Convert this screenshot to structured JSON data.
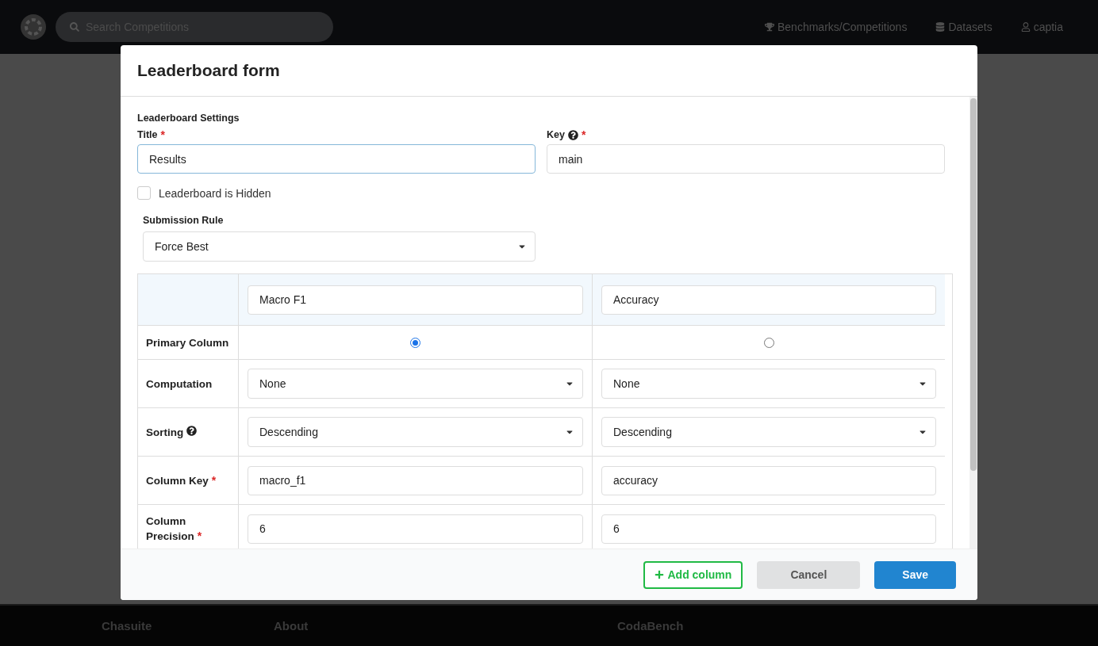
{
  "navbar": {
    "search": {
      "placeholder": "Search Competitions"
    },
    "links": [
      {
        "label": "Benchmarks/Competitions",
        "kind": "trophy"
      },
      {
        "label": "Datasets",
        "kind": "database"
      },
      {
        "label": "captia",
        "kind": "user"
      }
    ]
  },
  "modal": {
    "title": "Leaderboard form",
    "section_label": "Leaderboard Settings",
    "title_field": {
      "label": "Title",
      "required_mark": "*",
      "value": "Results"
    },
    "key_field": {
      "label": "Key",
      "required_mark": "*",
      "help": true,
      "value": "main"
    },
    "hidden_checkbox": {
      "label": "Leaderboard is Hidden",
      "checked": false
    },
    "submission_rule": {
      "label": "Submission Rule",
      "value": "Force Best"
    },
    "table": {
      "columns": [
        {
          "header": "Macro F1",
          "selected": true
        },
        {
          "header": "Accuracy",
          "selected": false
        }
      ],
      "rows": [
        {
          "kind": "radio",
          "label": "Primary Column",
          "help": false
        },
        {
          "kind": "select",
          "label": "Computation",
          "help": false,
          "values": [
            "None",
            "None"
          ]
        },
        {
          "kind": "select",
          "label": "Sorting",
          "help": true,
          "values": [
            "Descending",
            "Descending"
          ]
        },
        {
          "kind": "input",
          "label": "Column Key",
          "required_mark": "*",
          "help": false,
          "values": [
            "macro_f1",
            "accuracy"
          ]
        },
        {
          "kind": "input",
          "label": "Column Precision",
          "required_mark": "*",
          "help": false,
          "values": [
            "6",
            "6"
          ]
        }
      ]
    },
    "buttons": [
      {
        "label": "Add column",
        "kind": "add"
      },
      {
        "label": "Cancel",
        "kind": "cancel"
      },
      {
        "label": "Save",
        "kind": "primary"
      }
    ]
  },
  "footer": {
    "columns": [
      "Chasuite",
      "About",
      "CodaBench"
    ]
  }
}
